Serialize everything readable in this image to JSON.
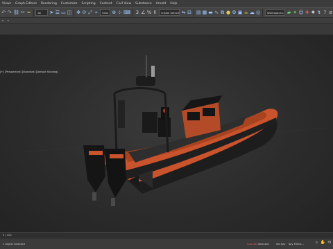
{
  "menu": [
    "Views",
    "Graph Editors",
    "Rendering",
    "Customize",
    "Scripting",
    "Content",
    "Civil View",
    "Substance",
    "Arnold",
    "Help"
  ],
  "toolbar": {
    "selection_filter": "All",
    "named_selection": "Create Selection Se",
    "workspace": "Workspaces: Default"
  },
  "viewport": {
    "label": "[+] [Perspective] [Standard] [Default Shading]"
  },
  "timeline": {
    "frame_counter": "0 / 100"
  },
  "status": {
    "selection_text": "1 Object Selected",
    "autokey": "Auto Key",
    "set_key": "Set Key",
    "selected_label": "Selected",
    "key_filters": "Key Filters..."
  },
  "colors": {
    "hull_orange": "#c9532c",
    "rail_black": "#1f1f1f",
    "accent": "#9ec6ff"
  }
}
